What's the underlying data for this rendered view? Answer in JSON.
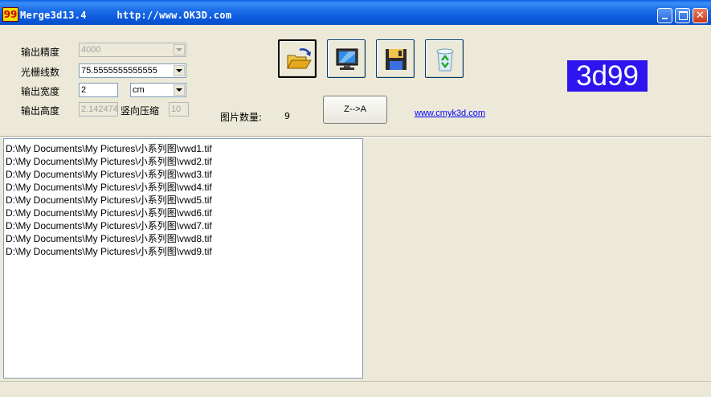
{
  "window": {
    "title": "Merge3d13.4     http://www.OK3D.com",
    "app_icon_text": "99",
    "close_glyph": "✕"
  },
  "form": {
    "precision": {
      "label": "输出精度",
      "value": "4000"
    },
    "lpi": {
      "label": "光栅线数",
      "value": "75.5555555555555"
    },
    "width": {
      "label": "输出宽度",
      "value": "2",
      "unit": "cm"
    },
    "height": {
      "label": "输出高度",
      "value": "2.142474"
    },
    "vcompress": {
      "label": "竖向压缩",
      "value": "10"
    }
  },
  "count": {
    "label": "图片数量:",
    "value": "9"
  },
  "sort_button": "Z-->A",
  "link": "www.cmyk3d.com",
  "badge": "3d99",
  "toolbar": {
    "icons": [
      "open-folder-icon",
      "monitor-icon",
      "floppy-save-icon",
      "recycle-bin-icon"
    ]
  },
  "files": [
    "D:\\My Documents\\My Pictures\\小系列图\\vwd1.tif",
    "D:\\My Documents\\My Pictures\\小系列图\\vwd2.tif",
    "D:\\My Documents\\My Pictures\\小系列图\\vwd3.tif",
    "D:\\My Documents\\My Pictures\\小系列图\\vwd4.tif",
    "D:\\My Documents\\My Pictures\\小系列图\\vwd5.tif",
    "D:\\My Documents\\My Pictures\\小系列图\\vwd6.tif",
    "D:\\My Documents\\My Pictures\\小系列图\\vwd7.tif",
    "D:\\My Documents\\My Pictures\\小系列图\\vwd8.tif",
    "D:\\My Documents\\My Pictures\\小系列图\\vwd9.tif"
  ],
  "colors": {
    "badge_bg": "#2e14ee",
    "title_bar": "#0a5ee3",
    "link": "#0000ff"
  }
}
